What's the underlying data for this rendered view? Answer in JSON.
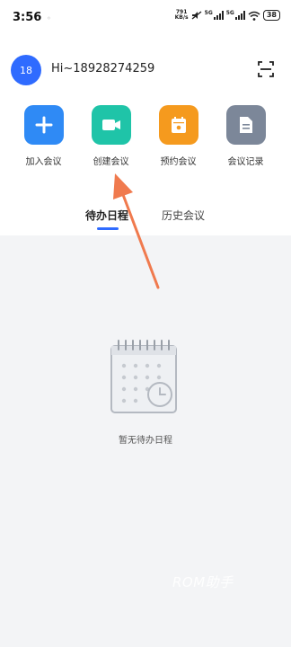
{
  "status_bar": {
    "time": "3:56",
    "net_speed": "791",
    "net_unit": "KB/s",
    "signal1_label": "5G",
    "signal2_label": "5G",
    "battery": "38"
  },
  "header": {
    "avatar_text": "18",
    "greeting": "Hi~18928274259"
  },
  "actions": [
    {
      "label": "加入会议",
      "color": "#2f8af5",
      "icon": "plus-icon"
    },
    {
      "label": "创建会议",
      "color": "#1fc4a8",
      "icon": "video-camera-icon"
    },
    {
      "label": "预约会议",
      "color": "#f59a1e",
      "icon": "calendar-icon"
    },
    {
      "label": "会议记录",
      "color": "#7c8799",
      "icon": "document-icon"
    }
  ],
  "tabs": {
    "active": "待办日程",
    "history": "历史会议"
  },
  "empty_state": {
    "text": "暂无待办日程"
  },
  "watermark": "ROM助手",
  "colors": {
    "accent": "#2f6bff",
    "annotation_arrow": "#f07a4e"
  }
}
